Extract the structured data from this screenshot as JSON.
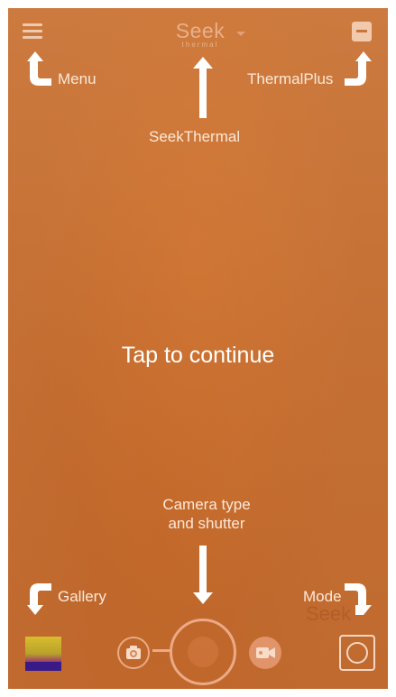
{
  "header": {
    "logo_main": "Seek",
    "logo_sub": "thermal"
  },
  "hints": {
    "menu": "Menu",
    "seekthermal": "SeekThermal",
    "thermalplus": "ThermalPlus",
    "camera_line1": "Camera type",
    "camera_line2": "and shutter",
    "gallery": "Gallery",
    "mode": "Mode"
  },
  "main": {
    "tap_label": "Tap to continue"
  },
  "background_watermark": "Seek",
  "colors": {
    "thermal_background": "#c8753b",
    "hint_text": "#fbe8d8",
    "control_outline": "#eba985"
  },
  "icons": {
    "menu": "hamburger-icon",
    "thermalplus": "minus-square-icon",
    "photo": "camera-icon",
    "video": "video-camera-icon",
    "mode": "circle-mode-icon"
  }
}
